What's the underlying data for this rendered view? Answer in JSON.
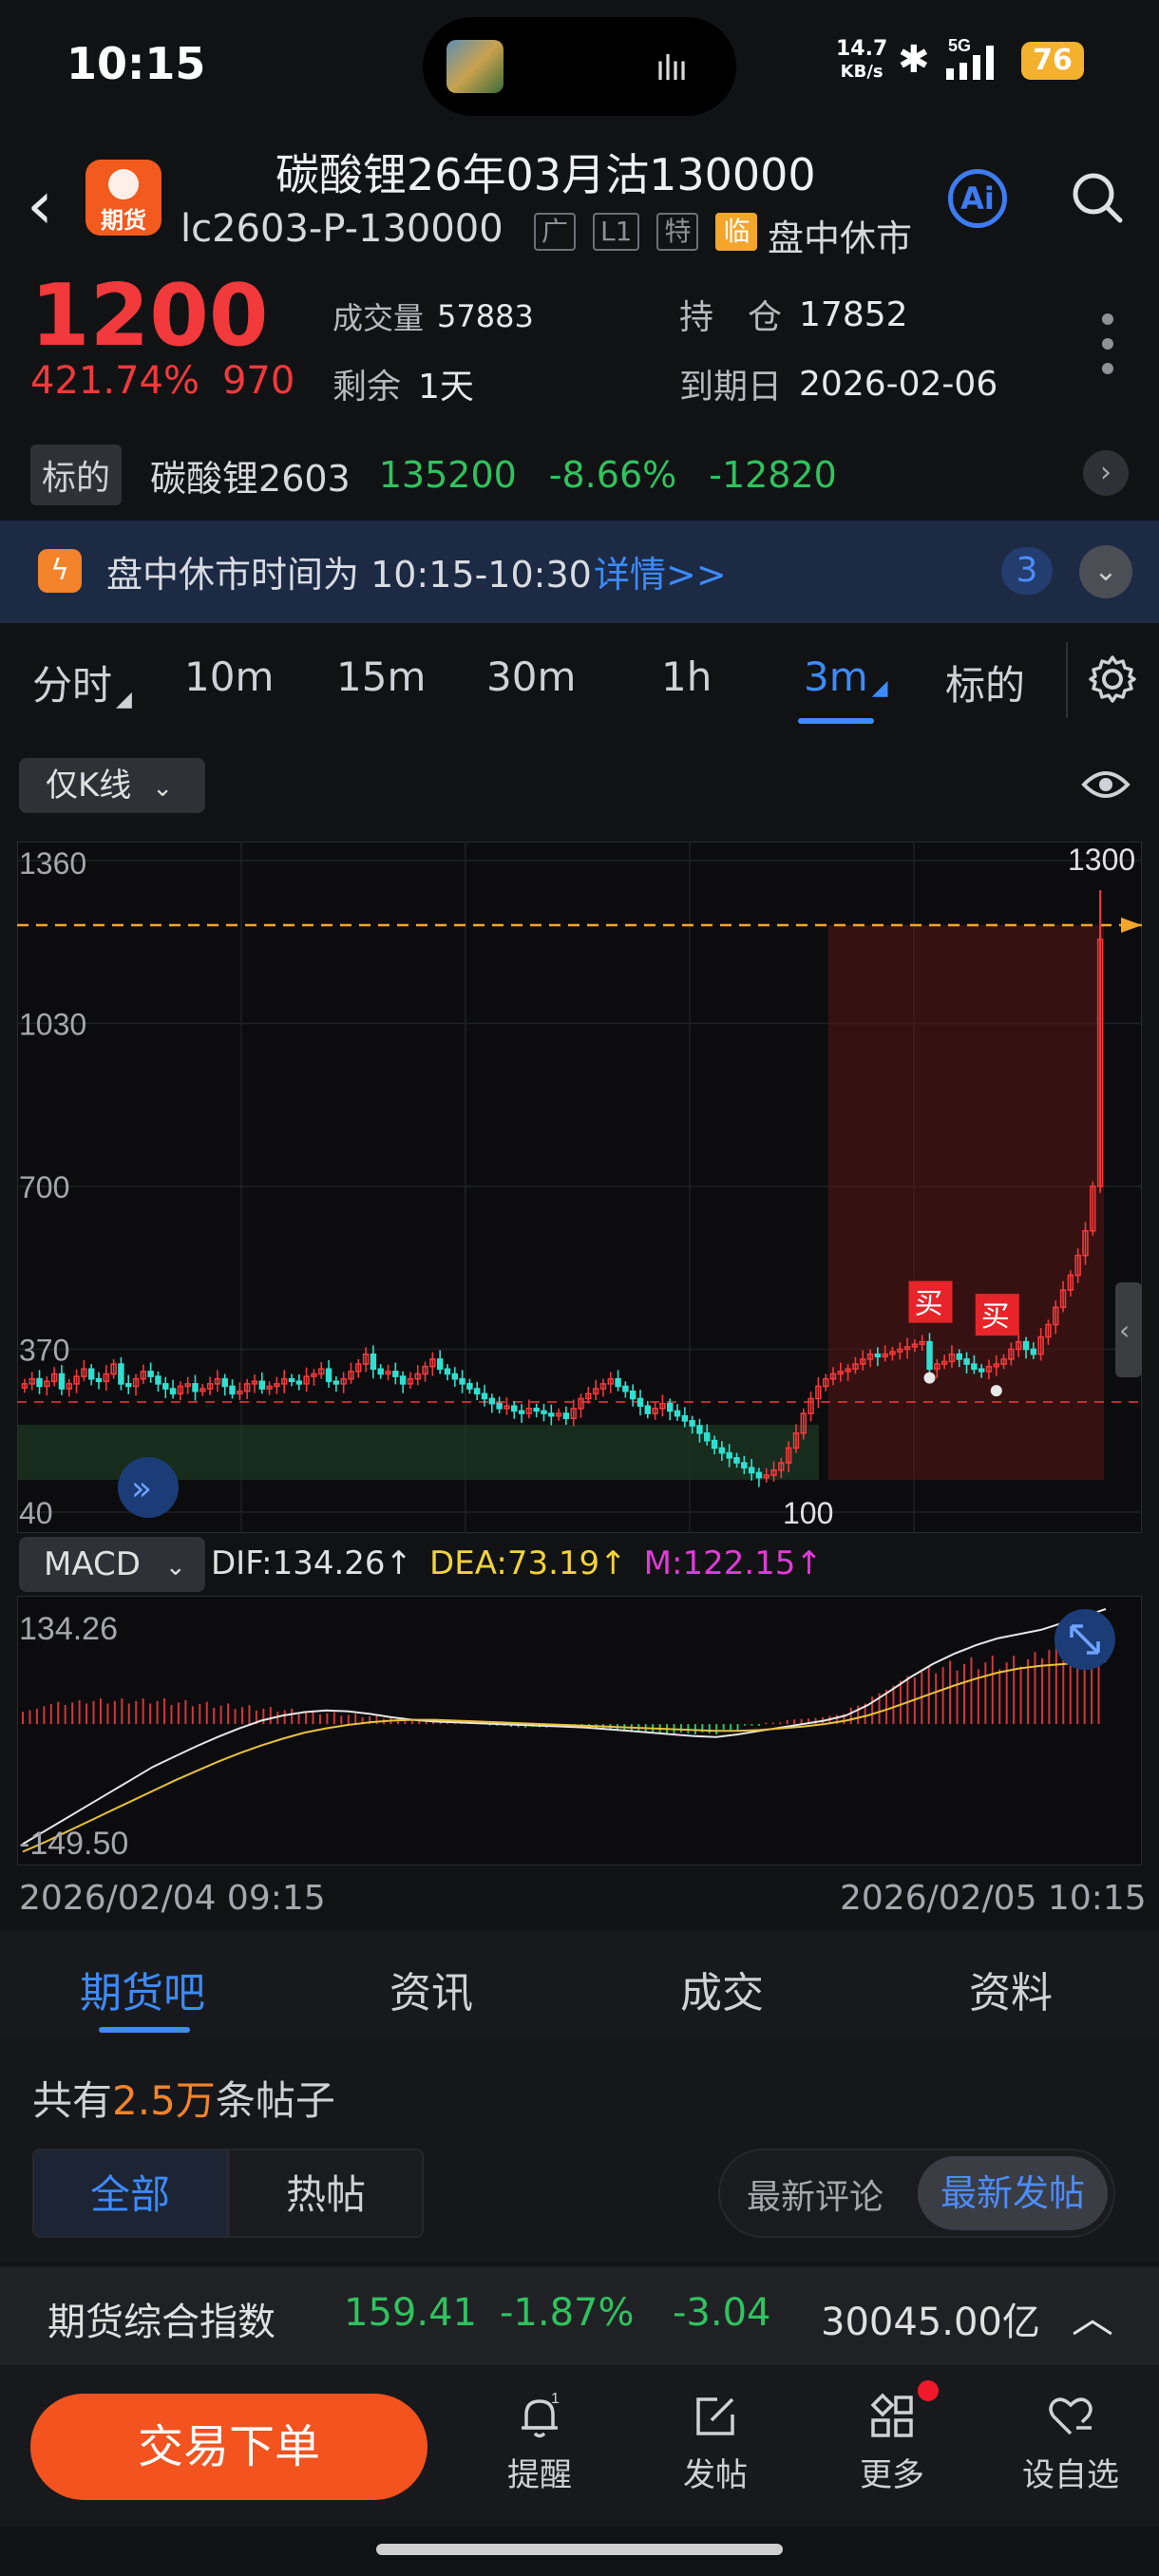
{
  "status": {
    "time": "10:15",
    "net_speed_top": "14.7",
    "net_speed_unit": "KB/s",
    "network": "5G",
    "battery": "76"
  },
  "header": {
    "logo_text": "期货",
    "title": "碳酸锂26年03月沽130000",
    "code": "lc2603-P-130000",
    "tags": [
      "广",
      "L1",
      "特",
      "临"
    ],
    "session": "盘中休市",
    "ai_label": "Ai"
  },
  "quote": {
    "price": "1200",
    "change_pct": "421.74%",
    "change_abs": "970",
    "volume_label": "成交量",
    "volume": "57883",
    "remaining_label": "剩余",
    "remaining": "1天",
    "oi_label": "持　仓",
    "oi": "17852",
    "expiry_label": "到期日",
    "expiry": "2026-02-06"
  },
  "underlying": {
    "tag": "标的",
    "name": "碳酸锂2603",
    "price": "135200",
    "pct": "-8.66%",
    "chg": "-12820"
  },
  "notice": {
    "text": "盘中休市时间为 10:15-10:30",
    "link": "详情>>",
    "count": "3"
  },
  "timeframes": [
    "分时",
    "10m",
    "15m",
    "30m",
    "1h",
    "3m",
    "标的"
  ],
  "active_timeframe": "3m",
  "chart_mode": "仅K线",
  "macd": {
    "label": "MACD",
    "dif": "DIF:134.26↑",
    "dea": "DEA:73.19↑",
    "m": "M:122.15↑"
  },
  "chart_data": [
    {
      "type": "candlestick",
      "y_ticks": [
        1360,
        1030,
        700,
        370,
        40
      ],
      "ylim": [
        40,
        1360
      ],
      "high_label": "1300",
      "low_label": "100",
      "buy_label": "买",
      "buy_markers": [
        {
          "index": 122,
          "price": 312
        },
        {
          "index": 131,
          "price": 286
        }
      ],
      "reference_price": 1200,
      "closes": [
        300,
        310,
        295,
        305,
        320,
        290,
        300,
        315,
        330,
        310,
        305,
        320,
        340,
        300,
        295,
        310,
        325,
        315,
        300,
        290,
        280,
        295,
        300,
        285,
        290,
        300,
        310,
        295,
        280,
        285,
        300,
        305,
        290,
        295,
        300,
        310,
        305,
        300,
        315,
        320,
        330,
        305,
        300,
        310,
        325,
        340,
        360,
        330,
        320,
        325,
        315,
        300,
        310,
        320,
        335,
        350,
        330,
        320,
        310,
        300,
        290,
        280,
        270,
        260,
        250,
        255,
        245,
        240,
        250,
        245,
        240,
        235,
        240,
        230,
        250,
        270,
        280,
        290,
        300,
        310,
        295,
        285,
        270,
        255,
        240,
        250,
        260,
        245,
        235,
        225,
        215,
        200,
        185,
        170,
        160,
        150,
        140,
        130,
        120,
        110,
        115,
        125,
        140,
        170,
        200,
        240,
        270,
        295,
        310,
        320,
        325,
        330,
        340,
        350,
        360,
        355,
        360,
        365,
        370,
        375,
        380,
        385,
        330,
        340,
        345,
        360,
        350,
        340,
        330,
        325,
        335,
        340,
        350,
        370,
        385,
        370,
        360,
        395,
        420,
        455,
        490,
        520,
        560,
        610,
        700,
        1200
      ],
      "date_start": "2026/02/04 09:15",
      "date_end": "2026/02/05 10:15"
    },
    {
      "type": "macd",
      "top_label": "134.26",
      "bottom_label": "-149.50",
      "ylim": [
        -149.5,
        134.26
      ],
      "dif": [
        -140,
        -125,
        -110,
        -95,
        -80,
        -65,
        -50,
        -38,
        -26,
        -15,
        -5,
        4,
        10,
        14,
        16,
        15,
        12,
        8,
        5,
        3,
        2,
        1,
        0,
        -1,
        -2,
        -3,
        -4,
        -6,
        -8,
        -10,
        -12,
        -14,
        -15,
        -12,
        -8,
        -4,
        0,
        4,
        10,
        22,
        38,
        55,
        70,
        82,
        92,
        100,
        105,
        110,
        118,
        126,
        134.26
      ],
      "dea": [
        -149,
        -138,
        -126,
        -114,
        -102,
        -90,
        -78,
        -66,
        -55,
        -44,
        -34,
        -25,
        -17,
        -10,
        -5,
        -1,
        2,
        4,
        5,
        5,
        4,
        3,
        2,
        1,
        0,
        -1,
        -2,
        -3,
        -4,
        -5,
        -6,
        -7,
        -8,
        -8,
        -7,
        -5,
        -3,
        0,
        4,
        10,
        18,
        27,
        36,
        45,
        53,
        60,
        65,
        68,
        70,
        72,
        73.19
      ],
      "hist": [
        18,
        26,
        28,
        30,
        30,
        30,
        30,
        28,
        26,
        24,
        22,
        20,
        18,
        16,
        14,
        12,
        10,
        8,
        6,
        4,
        2,
        0,
        -2,
        -4,
        -4,
        -4,
        -4,
        -6,
        -8,
        -10,
        -12,
        -12,
        -12,
        -8,
        -2,
        2,
        6,
        8,
        12,
        24,
        40,
        56,
        68,
        74,
        78,
        80,
        80,
        84,
        96,
        108,
        122.15
      ]
    }
  ],
  "content_tabs": [
    "期货吧",
    "资讯",
    "成交",
    "资料"
  ],
  "posts": {
    "prefix": "共有",
    "count": "2.5万",
    "suffix": "条帖子",
    "filters": [
      "全部",
      "热帖"
    ],
    "sorts": [
      "最新评论",
      "最新发帖"
    ]
  },
  "index_bar": {
    "name": "期货综合指数",
    "value": "159.41",
    "pct": "-1.87%",
    "chg": "-3.04",
    "amount": "30045.00亿"
  },
  "bottom_nav": {
    "trade": "交易下单",
    "items": [
      "提醒",
      "发帖",
      "更多",
      "设自选"
    ],
    "reminder_badge": "1"
  },
  "colors": {
    "up": "#f2393b",
    "down": "#2fc35f",
    "accent": "#3d8bff",
    "brand": "#f3531f"
  }
}
